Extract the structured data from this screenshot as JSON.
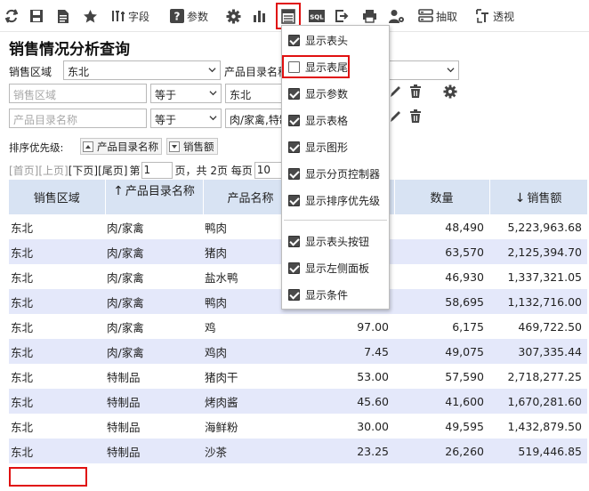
{
  "toolbar": {
    "field_label": "字段",
    "param_label": "参数",
    "sql_label": "SQL",
    "extract_label": "抽取",
    "pivot_label": "透视"
  },
  "page_title": "销售情况分析查询",
  "conditions": {
    "region_label": "销售区域",
    "region_value": "东北",
    "category_label": "产品目录名称",
    "row1_field_placeholder": "销售区域",
    "row1_operator": "等于",
    "row1_value": "东北",
    "row2_field_placeholder": "产品目录名称",
    "row2_operator": "等于",
    "row2_value": "肉/家禽,特制品"
  },
  "sort": {
    "title": "排序优先级:",
    "chip1": "产品目录名称",
    "chip2": "销售额"
  },
  "pager": {
    "first": "[首页]",
    "prev": "[上页]",
    "next": "[下页]",
    "last": "[尾页]",
    "page_prefix": "第",
    "page_value": "1",
    "page_suffix": "页，共 2页 每页",
    "page_size": "10"
  },
  "table": {
    "headers": {
      "region": "销售区域",
      "category": "产品目录名称",
      "category_arrow": "↑",
      "product": "产品名称",
      "price": "",
      "qty": "数量",
      "sales": "销售额",
      "sales_arrow": "↓"
    },
    "rows": [
      {
        "region": "东北",
        "category": "肉/家禽",
        "product": "鸭肉",
        "price": "",
        "qty": "48,490",
        "sales": "5,223,963.68"
      },
      {
        "region": "东北",
        "category": "肉/家禽",
        "product": "猪肉",
        "price": "",
        "qty": "63,570",
        "sales": "2,125,394.70"
      },
      {
        "region": "东北",
        "category": "肉/家禽",
        "product": "盐水鸭",
        "price": "",
        "qty": "46,930",
        "sales": "1,337,321.05"
      },
      {
        "region": "东北",
        "category": "肉/家禽",
        "product": "鸭肉",
        "price": "",
        "qty": "58,695",
        "sales": "1,132,716.00"
      },
      {
        "region": "东北",
        "category": "肉/家禽",
        "product": "鸡",
        "price": "97.00",
        "qty": "6,175",
        "sales": "469,722.50"
      },
      {
        "region": "东北",
        "category": "肉/家禽",
        "product": "鸡肉",
        "price": "7.45",
        "qty": "49,075",
        "sales": "307,335.44"
      },
      {
        "region": "东北",
        "category": "特制品",
        "product": "猪肉干",
        "price": "53.00",
        "qty": "57,590",
        "sales": "2,718,277.25"
      },
      {
        "region": "东北",
        "category": "特制品",
        "product": "烤肉酱",
        "price": "45.60",
        "qty": "41,600",
        "sales": "1,670,281.60"
      },
      {
        "region": "东北",
        "category": "特制品",
        "product": "海鲜粉",
        "price": "30.00",
        "qty": "49,595",
        "sales": "1,432,879.50"
      },
      {
        "region": "东北",
        "category": "特制品",
        "product": "沙茶",
        "price": "23.25",
        "qty": "26,260",
        "sales": "519,446.85"
      }
    ]
  },
  "popup": {
    "items": [
      {
        "label": "显示表头"
      },
      {
        "label": "显示表尾"
      },
      {
        "label": "显示参数"
      },
      {
        "label": "显示表格"
      },
      {
        "label": "显示图形"
      },
      {
        "label": "显示分页控制器"
      },
      {
        "label": "显示排序优先级"
      },
      {
        "label": "显示表头按钮"
      },
      {
        "label": "显示左侧面板"
      },
      {
        "label": "显示条件"
      }
    ]
  },
  "colors": {
    "header_bg": "#d8e3f3",
    "stripe_bg": "#e4e8fa",
    "highlight": "#e01010"
  }
}
